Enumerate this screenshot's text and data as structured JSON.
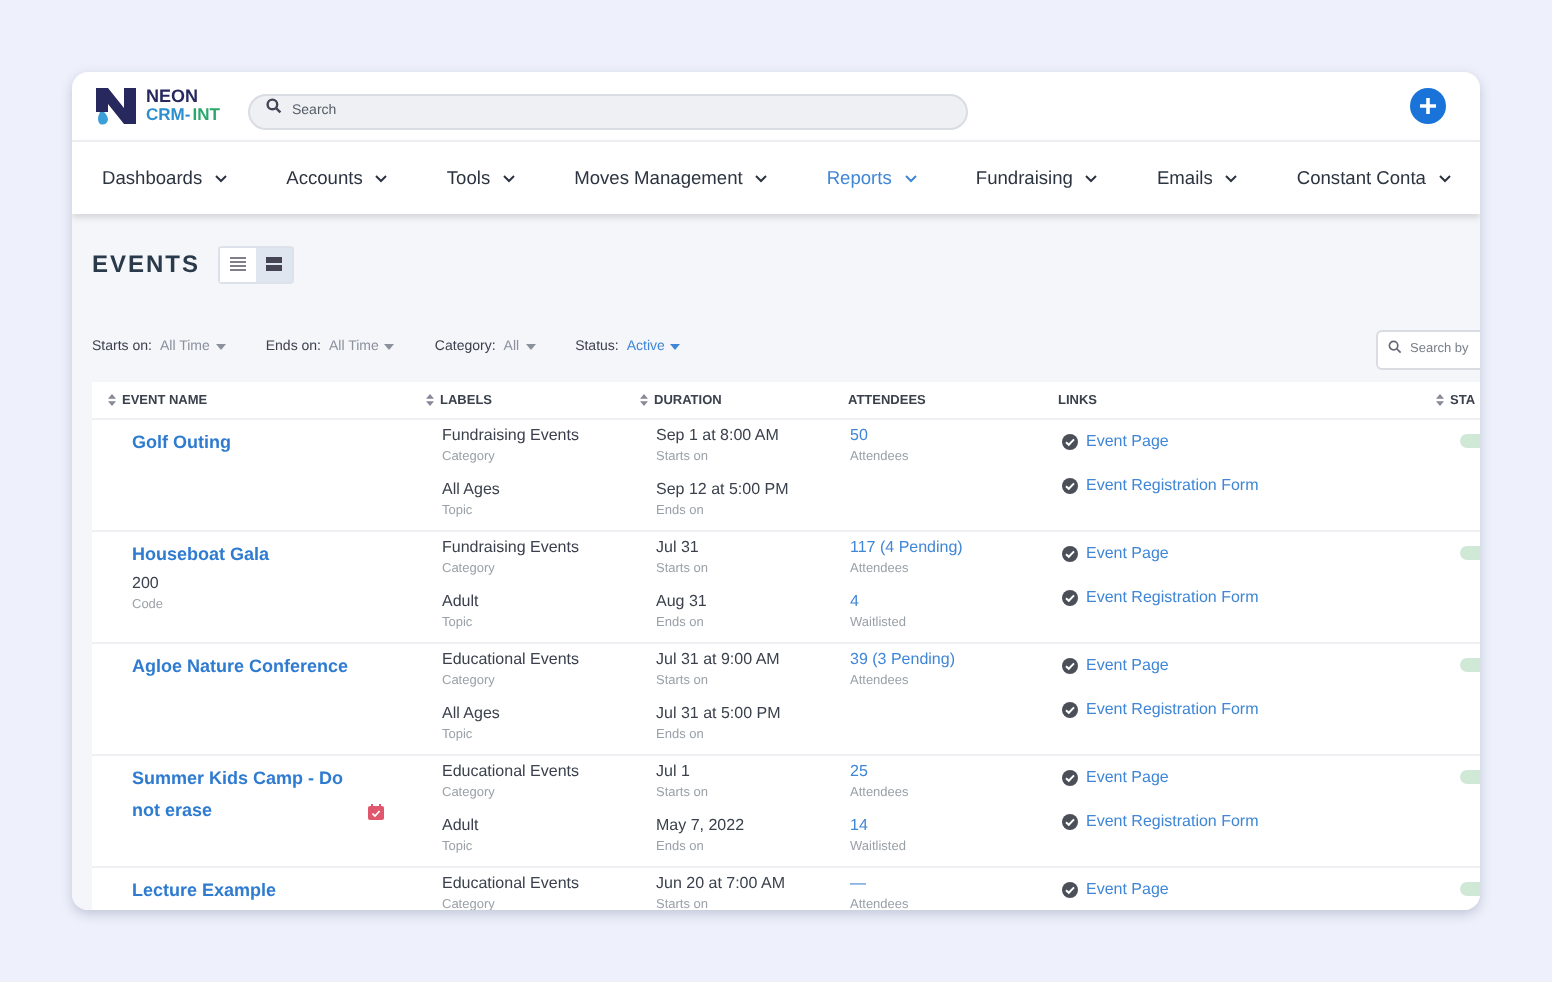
{
  "logo": {
    "line1": "NEON",
    "line2": "CRM-",
    "suffix": "INT"
  },
  "search": {
    "placeholder": "Search"
  },
  "nav": [
    {
      "label": "Dashboards",
      "selected": false
    },
    {
      "label": "Accounts",
      "selected": false
    },
    {
      "label": "Tools",
      "selected": false
    },
    {
      "label": "Moves Management",
      "selected": false
    },
    {
      "label": "Reports",
      "selected": true
    },
    {
      "label": "Fundraising",
      "selected": false
    },
    {
      "label": "Emails",
      "selected": false
    },
    {
      "label": "Constant Conta",
      "selected": false
    }
  ],
  "page_title": "EVENTS",
  "views": [
    {
      "kind": "list",
      "selected": false
    },
    {
      "kind": "compact",
      "selected": true
    }
  ],
  "filters": [
    {
      "label": "Starts on:",
      "value": "All Time",
      "highlighted": false
    },
    {
      "label": "Ends on:",
      "value": "All Time",
      "highlighted": false
    },
    {
      "label": "Category:",
      "value": "All",
      "highlighted": false
    },
    {
      "label": "Status:",
      "value": "Active",
      "highlighted": true
    }
  ],
  "table_search": {
    "placeholder": "Search by"
  },
  "table": {
    "columns": [
      {
        "label": "EVENT NAME",
        "sortable": true
      },
      {
        "label": "LABELS",
        "sortable": true
      },
      {
        "label": "DURATION",
        "sortable": true
      },
      {
        "label": "ATTENDEES",
        "sortable": false
      },
      {
        "label": "LINKS",
        "sortable": false
      },
      {
        "label": "STA",
        "sortable": true
      }
    ],
    "rows": [
      {
        "name": "Golf Outing",
        "calendar_badge": false,
        "code": null,
        "labels": [
          {
            "value": "Fundraising Events",
            "label": "Category"
          },
          {
            "value": "All Ages",
            "label": "Topic"
          }
        ],
        "duration": [
          {
            "value": "Sep 1 at 8:00 AM",
            "label": "Starts on"
          },
          {
            "value": "Sep 12 at 5:00 PM",
            "label": "Ends on"
          }
        ],
        "attendees": [
          {
            "value": "50",
            "label": "Attendees"
          }
        ],
        "links": [
          "Event Page",
          "Event Registration Form"
        ],
        "status_on": true
      },
      {
        "name": "Houseboat Gala",
        "calendar_badge": false,
        "code": {
          "value": "200",
          "label": "Code"
        },
        "labels": [
          {
            "value": "Fundraising Events",
            "label": "Category"
          },
          {
            "value": "Adult",
            "label": "Topic"
          }
        ],
        "duration": [
          {
            "value": "Jul 31",
            "label": "Starts on"
          },
          {
            "value": "Aug 31",
            "label": "Ends on"
          }
        ],
        "attendees": [
          {
            "value": "117 (4 Pending)",
            "label": "Attendees"
          },
          {
            "value": "4",
            "label": "Waitlisted"
          }
        ],
        "links": [
          "Event Page",
          "Event Registration Form"
        ],
        "status_on": true
      },
      {
        "name": "Agloe Nature Conference",
        "calendar_badge": false,
        "code": null,
        "labels": [
          {
            "value": "Educational Events",
            "label": "Category"
          },
          {
            "value": "All Ages",
            "label": "Topic"
          }
        ],
        "duration": [
          {
            "value": "Jul 31 at 9:00 AM",
            "label": "Starts on"
          },
          {
            "value": "Jul 31 at 5:00 PM",
            "label": "Ends on"
          }
        ],
        "attendees": [
          {
            "value": "39 (3 Pending)",
            "label": "Attendees"
          }
        ],
        "links": [
          "Event Page",
          "Event Registration Form"
        ],
        "status_on": true
      },
      {
        "name": "Summer Kids Camp - Do not erase",
        "calendar_badge": true,
        "code": null,
        "labels": [
          {
            "value": "Educational Events",
            "label": "Category"
          },
          {
            "value": "Adult",
            "label": "Topic"
          }
        ],
        "duration": [
          {
            "value": "Jul 1",
            "label": "Starts on"
          },
          {
            "value": "May 7, 2022",
            "label": "Ends on"
          }
        ],
        "attendees": [
          {
            "value": "25",
            "label": "Attendees"
          },
          {
            "value": "14",
            "label": "Waitlisted"
          }
        ],
        "links": [
          "Event Page",
          "Event Registration Form"
        ],
        "status_on": true
      },
      {
        "name": "Lecture Example",
        "calendar_badge": false,
        "code": null,
        "labels": [
          {
            "value": "Educational Events",
            "label": "Category"
          }
        ],
        "duration": [
          {
            "value": "Jun 20 at 7:00 AM",
            "label": "Starts on"
          }
        ],
        "attendees": [
          {
            "value": "—",
            "label": "Attendees"
          }
        ],
        "links": [
          "Event Page"
        ],
        "status_on": true
      }
    ]
  }
}
